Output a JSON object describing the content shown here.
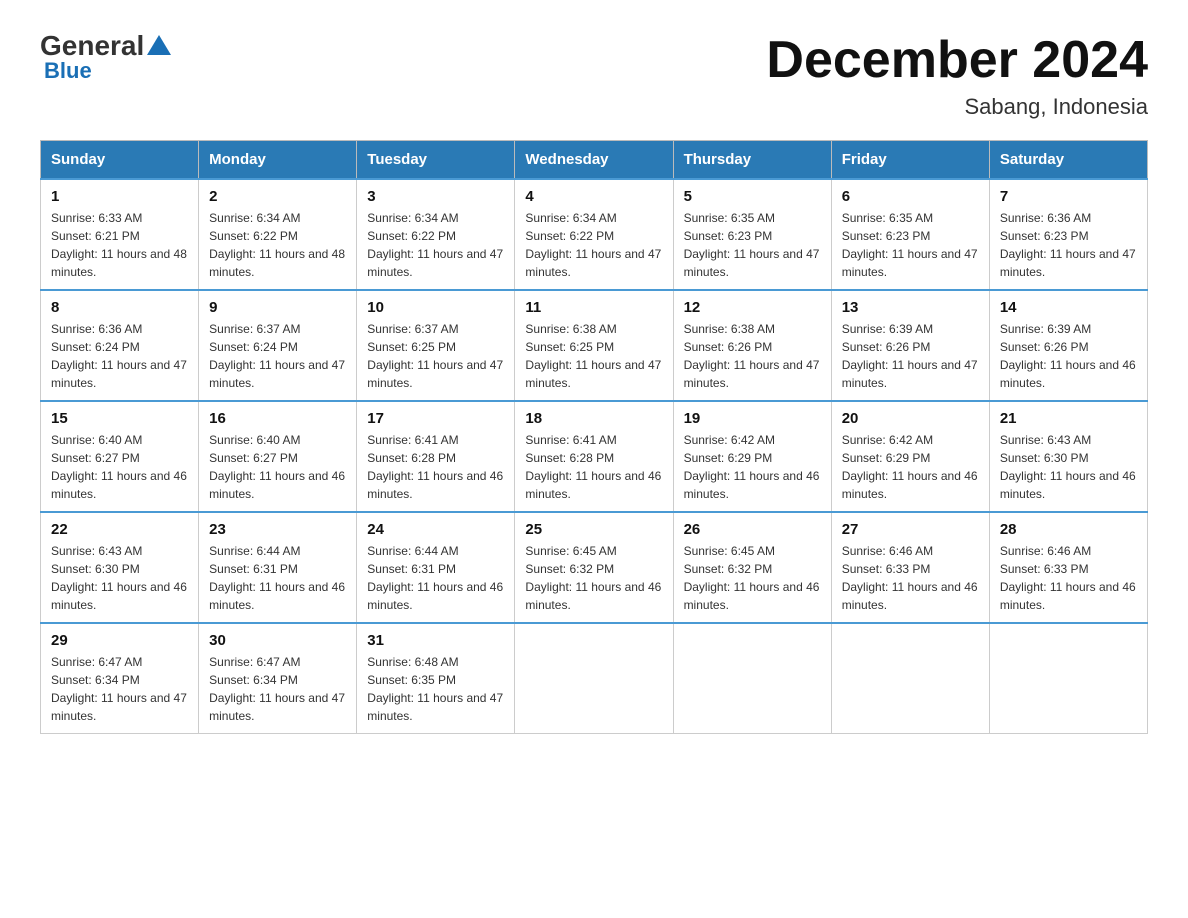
{
  "header": {
    "logo_general": "General",
    "logo_blue": "Blue",
    "month_title": "December 2024",
    "location": "Sabang, Indonesia"
  },
  "days_of_week": [
    "Sunday",
    "Monday",
    "Tuesday",
    "Wednesday",
    "Thursday",
    "Friday",
    "Saturday"
  ],
  "weeks": [
    [
      {
        "day": "1",
        "sunrise": "6:33 AM",
        "sunset": "6:21 PM",
        "daylight": "11 hours and 48 minutes."
      },
      {
        "day": "2",
        "sunrise": "6:34 AM",
        "sunset": "6:22 PM",
        "daylight": "11 hours and 48 minutes."
      },
      {
        "day": "3",
        "sunrise": "6:34 AM",
        "sunset": "6:22 PM",
        "daylight": "11 hours and 47 minutes."
      },
      {
        "day": "4",
        "sunrise": "6:34 AM",
        "sunset": "6:22 PM",
        "daylight": "11 hours and 47 minutes."
      },
      {
        "day": "5",
        "sunrise": "6:35 AM",
        "sunset": "6:23 PM",
        "daylight": "11 hours and 47 minutes."
      },
      {
        "day": "6",
        "sunrise": "6:35 AM",
        "sunset": "6:23 PM",
        "daylight": "11 hours and 47 minutes."
      },
      {
        "day": "7",
        "sunrise": "6:36 AM",
        "sunset": "6:23 PM",
        "daylight": "11 hours and 47 minutes."
      }
    ],
    [
      {
        "day": "8",
        "sunrise": "6:36 AM",
        "sunset": "6:24 PM",
        "daylight": "11 hours and 47 minutes."
      },
      {
        "day": "9",
        "sunrise": "6:37 AM",
        "sunset": "6:24 PM",
        "daylight": "11 hours and 47 minutes."
      },
      {
        "day": "10",
        "sunrise": "6:37 AM",
        "sunset": "6:25 PM",
        "daylight": "11 hours and 47 minutes."
      },
      {
        "day": "11",
        "sunrise": "6:38 AM",
        "sunset": "6:25 PM",
        "daylight": "11 hours and 47 minutes."
      },
      {
        "day": "12",
        "sunrise": "6:38 AM",
        "sunset": "6:26 PM",
        "daylight": "11 hours and 47 minutes."
      },
      {
        "day": "13",
        "sunrise": "6:39 AM",
        "sunset": "6:26 PM",
        "daylight": "11 hours and 47 minutes."
      },
      {
        "day": "14",
        "sunrise": "6:39 AM",
        "sunset": "6:26 PM",
        "daylight": "11 hours and 46 minutes."
      }
    ],
    [
      {
        "day": "15",
        "sunrise": "6:40 AM",
        "sunset": "6:27 PM",
        "daylight": "11 hours and 46 minutes."
      },
      {
        "day": "16",
        "sunrise": "6:40 AM",
        "sunset": "6:27 PM",
        "daylight": "11 hours and 46 minutes."
      },
      {
        "day": "17",
        "sunrise": "6:41 AM",
        "sunset": "6:28 PM",
        "daylight": "11 hours and 46 minutes."
      },
      {
        "day": "18",
        "sunrise": "6:41 AM",
        "sunset": "6:28 PM",
        "daylight": "11 hours and 46 minutes."
      },
      {
        "day": "19",
        "sunrise": "6:42 AM",
        "sunset": "6:29 PM",
        "daylight": "11 hours and 46 minutes."
      },
      {
        "day": "20",
        "sunrise": "6:42 AM",
        "sunset": "6:29 PM",
        "daylight": "11 hours and 46 minutes."
      },
      {
        "day": "21",
        "sunrise": "6:43 AM",
        "sunset": "6:30 PM",
        "daylight": "11 hours and 46 minutes."
      }
    ],
    [
      {
        "day": "22",
        "sunrise": "6:43 AM",
        "sunset": "6:30 PM",
        "daylight": "11 hours and 46 minutes."
      },
      {
        "day": "23",
        "sunrise": "6:44 AM",
        "sunset": "6:31 PM",
        "daylight": "11 hours and 46 minutes."
      },
      {
        "day": "24",
        "sunrise": "6:44 AM",
        "sunset": "6:31 PM",
        "daylight": "11 hours and 46 minutes."
      },
      {
        "day": "25",
        "sunrise": "6:45 AM",
        "sunset": "6:32 PM",
        "daylight": "11 hours and 46 minutes."
      },
      {
        "day": "26",
        "sunrise": "6:45 AM",
        "sunset": "6:32 PM",
        "daylight": "11 hours and 46 minutes."
      },
      {
        "day": "27",
        "sunrise": "6:46 AM",
        "sunset": "6:33 PM",
        "daylight": "11 hours and 46 minutes."
      },
      {
        "day": "28",
        "sunrise": "6:46 AM",
        "sunset": "6:33 PM",
        "daylight": "11 hours and 46 minutes."
      }
    ],
    [
      {
        "day": "29",
        "sunrise": "6:47 AM",
        "sunset": "6:34 PM",
        "daylight": "11 hours and 47 minutes."
      },
      {
        "day": "30",
        "sunrise": "6:47 AM",
        "sunset": "6:34 PM",
        "daylight": "11 hours and 47 minutes."
      },
      {
        "day": "31",
        "sunrise": "6:48 AM",
        "sunset": "6:35 PM",
        "daylight": "11 hours and 47 minutes."
      },
      null,
      null,
      null,
      null
    ]
  ]
}
